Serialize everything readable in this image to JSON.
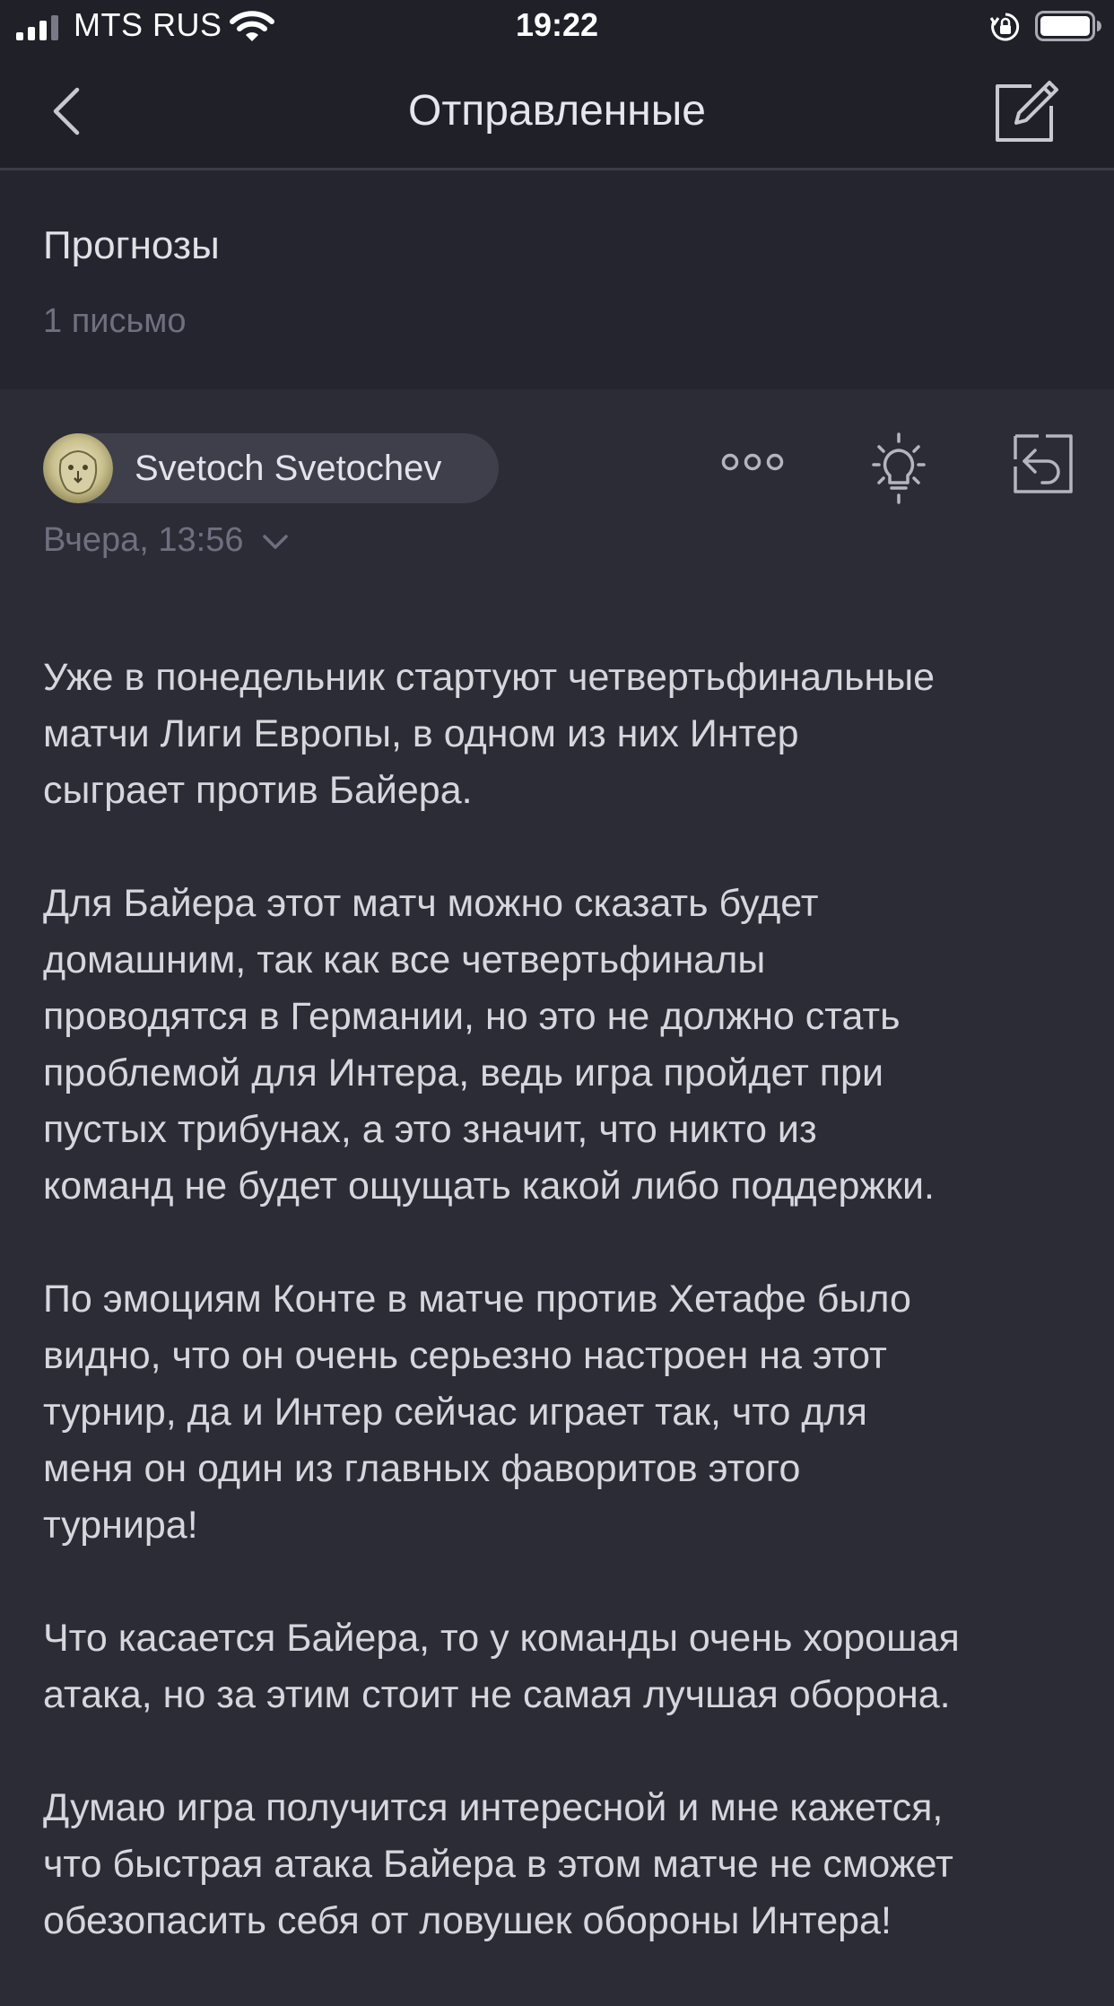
{
  "status_bar": {
    "carrier": "MTS RUS",
    "time": "19:22",
    "icons": [
      "signal-icon",
      "wifi-icon",
      "orientation-lock-icon",
      "battery-icon"
    ]
  },
  "nav": {
    "title": "Отправленные",
    "back_icon": "chevron-left-icon",
    "compose_icon": "compose-icon"
  },
  "thread": {
    "subject": "Прогнозы",
    "count": "1 письмо"
  },
  "message": {
    "sender": "Svetoch Svetochev",
    "date": "Вчера, 13:56",
    "actions": [
      "more-icon",
      "lightbulb-icon",
      "reply-icon"
    ],
    "paragraphs": [
      "Уже в понедельник стартуют четвертьфинальные\nматчи Лиги Европы, в одном из них Интер\nсыграет против Байера.",
      "Для Байера этот матч можно сказать будет\nдомашним, так как все четвертьфиналы\nпроводятся в Германии, но это не должно стать\nпроблемой для Интера, ведь игра пройдет при\nпустых трибунах, а это значит, что никто из\nкоманд не будет ощущать какой либо поддержки.",
      "По эмоциям Конте в матче против Хетафе было\nвидно, что он очень серьезно настроен на этот\nтурнир, да и Интер сейчас играет так, что для\nменя он один из главных фаворитов этого\nтурнира!",
      "Что касается Байера, то у команды очень хорошая\nатака, но за этим стоит не самая лучшая оборона.",
      "Думаю игра получится интересной и мне кажется,\nчто быстрая атака Байера в этом матче не сможет\nобезопасить себя от ловушек обороны Интера!"
    ]
  },
  "colors": {
    "background": "#2b2c36",
    "header_background": "#1f2028",
    "thread_background": "#24252e",
    "chip_background": "#3e3f4b",
    "muted_text": "#6e7080",
    "body_text": "#d6d7dd"
  }
}
